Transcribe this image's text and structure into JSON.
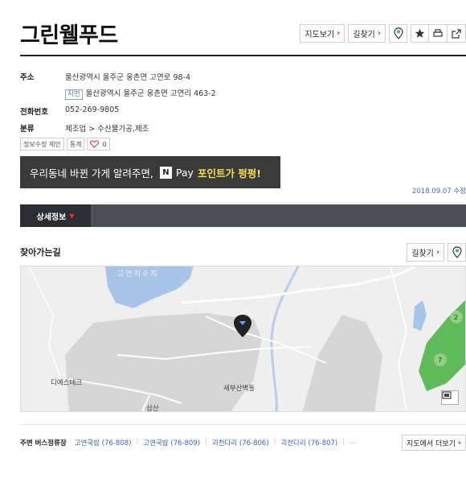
{
  "header": {
    "title": "그린웰푸드"
  },
  "toolbar": {
    "map_view": "지도보기",
    "directions": "길찾기",
    "arrow": "›"
  },
  "info": {
    "address_label": "주소",
    "address": "울산광역시 울주군 웅촌면 고연로 98-4",
    "jibun_badge": "지번",
    "jibun_address": "울산광역시 울주군 웅촌면 고연리 463-2",
    "phone_label": "전화번호",
    "phone": "052-269-9805",
    "category_label": "분류",
    "category": "제조업 > 수산물가공,제조"
  },
  "minis": {
    "suggest_edit": "정보수정 제안",
    "stats": "통계",
    "likes": "0"
  },
  "banner": {
    "text": "우리동네 바뀐 가게 알려주면,",
    "npay_n": "N",
    "npay": "Pay",
    "highlight": "포인트가 펑펑!"
  },
  "updated": "2018.09.07 수정",
  "tabs": {
    "active": "상세정보"
  },
  "directions_section": {
    "title": "찾아가는길",
    "button": "길찾기"
  },
  "map": {
    "labels": {
      "reservoir": "고연저수지",
      "company1": "디에스테크",
      "company2": "새부산벽돌",
      "mountain": "삼산"
    },
    "golf_marks": [
      "2",
      "7"
    ],
    "colors": {
      "water": "#a8c4e6",
      "land": "#d9d9d9",
      "green": "#5fba5a",
      "marker": "#222"
    }
  },
  "bus": {
    "label": "주변 버스정류장",
    "stops": [
      "고연국밥 (76-808)",
      "고연국밥 (76-809)",
      "괴천다리 (76-806)",
      "괴천다리 (76-807)"
    ],
    "more": "...",
    "map_more": "지도에서 더보기"
  }
}
